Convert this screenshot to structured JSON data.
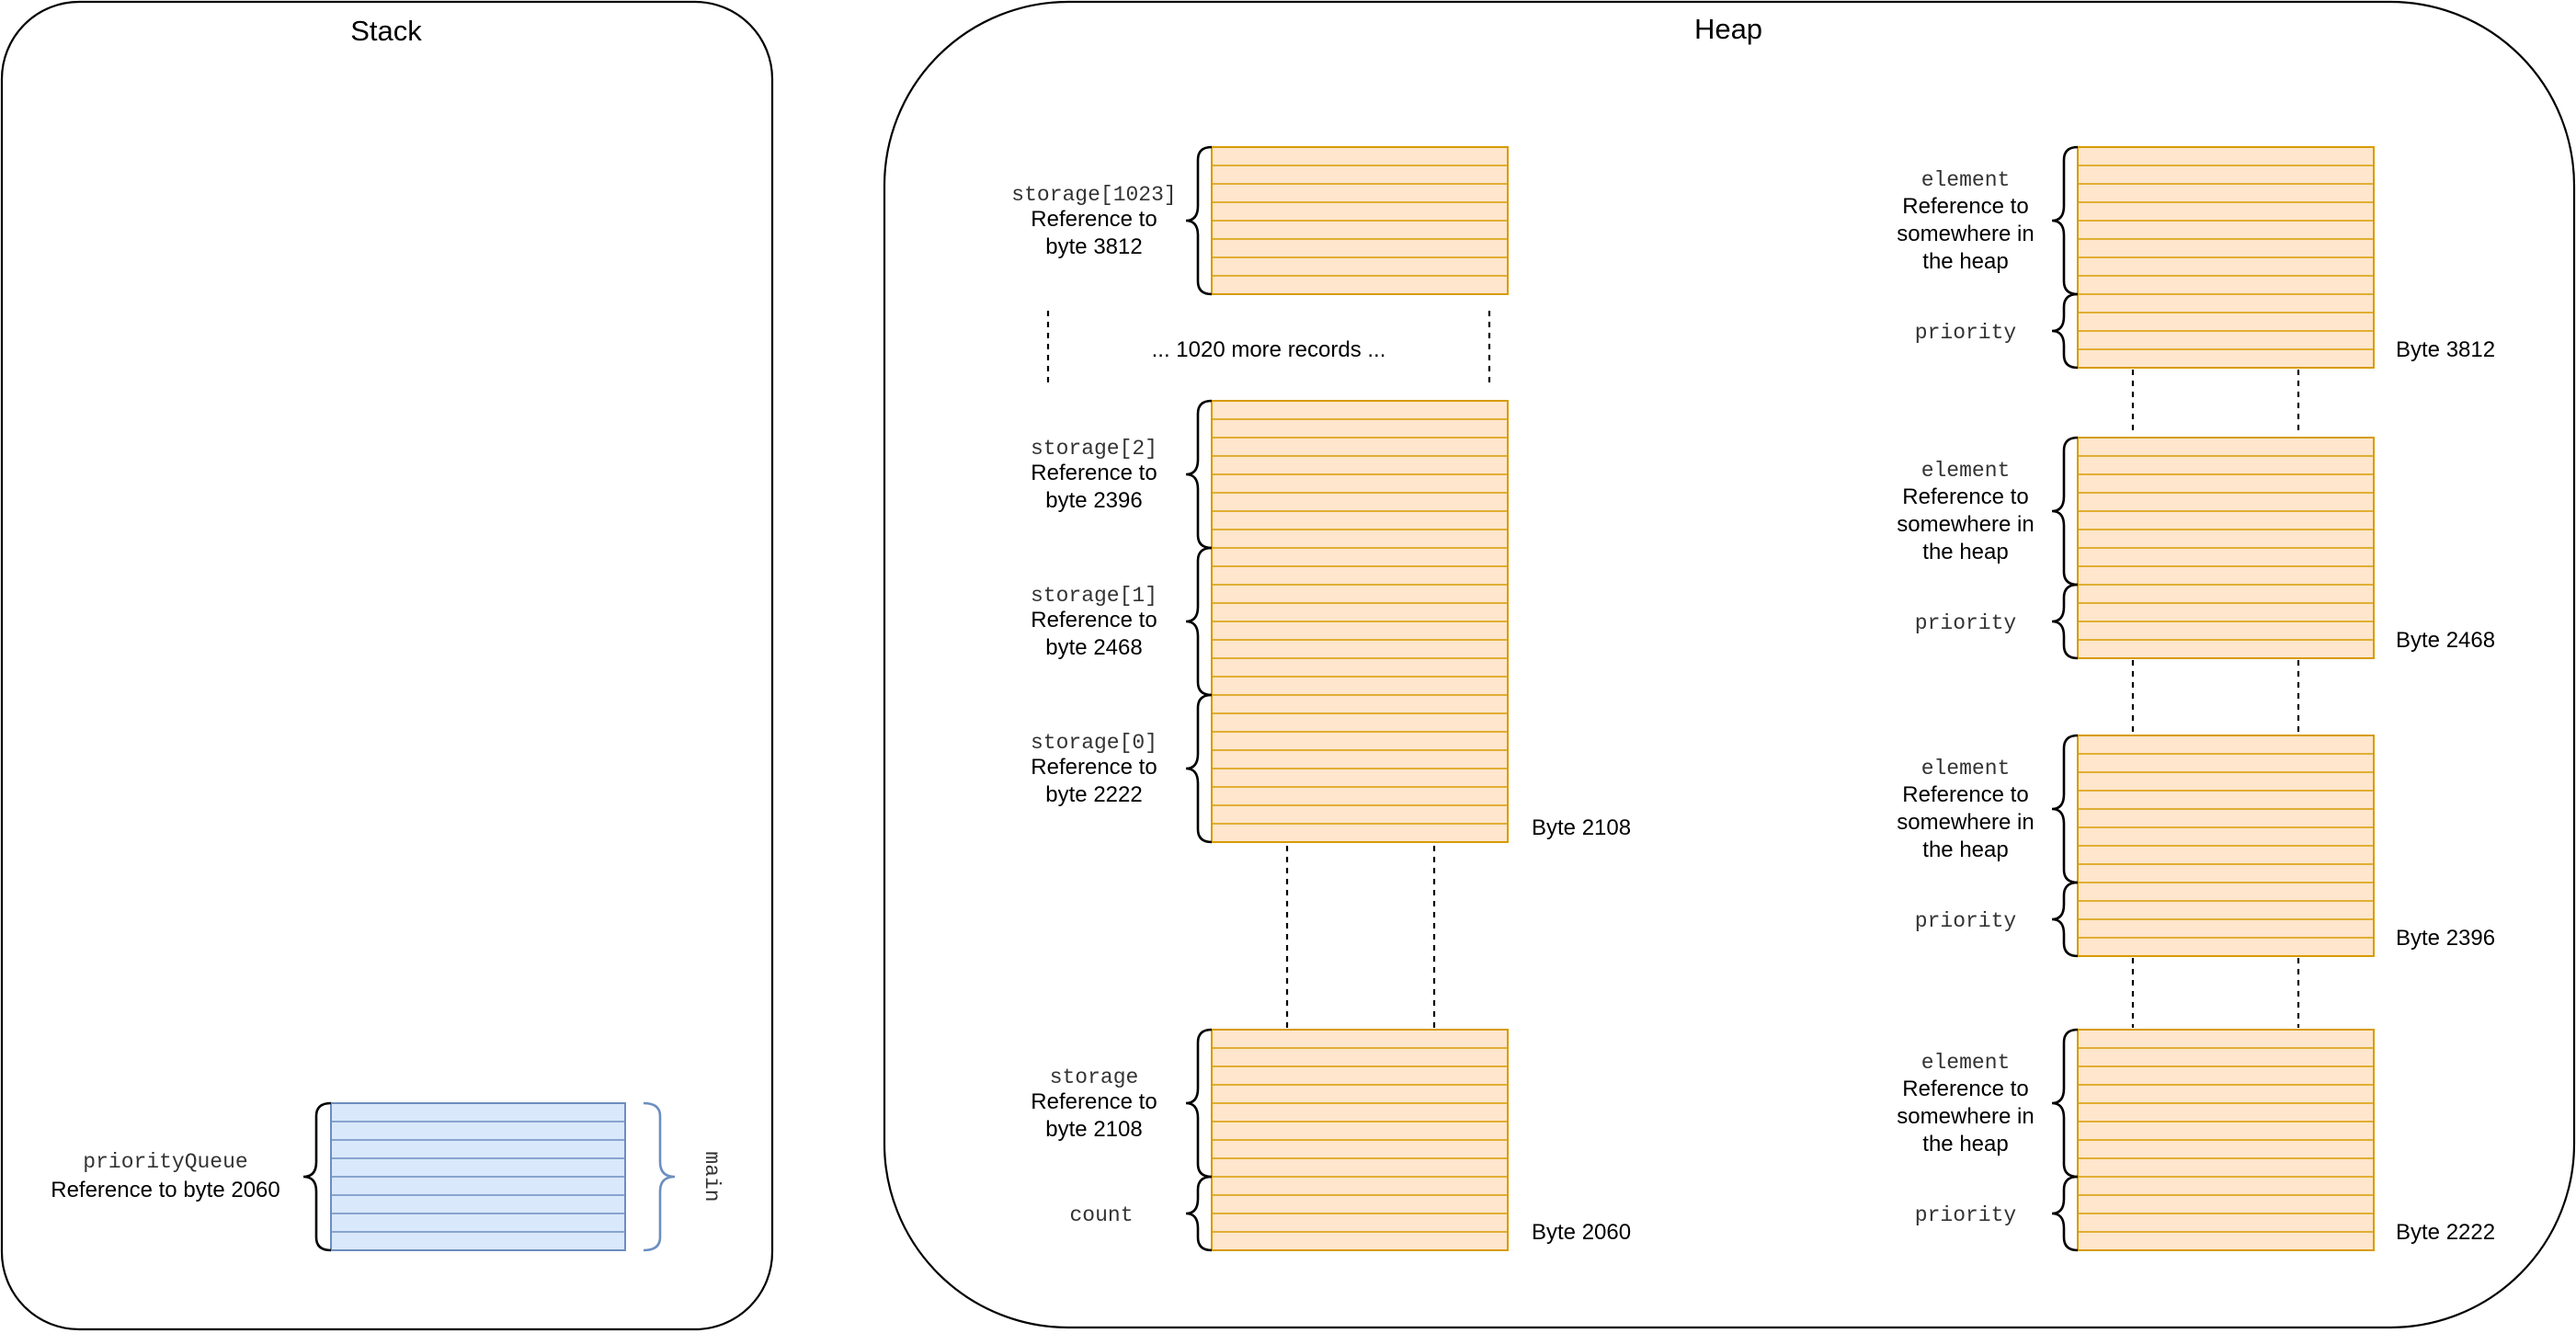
{
  "colors": {
    "stack_fill": "#dae8fc",
    "stack_stroke": "#6c8ebf",
    "heap_fill": "#ffe6cc",
    "heap_stroke": "#d79b00"
  },
  "stack": {
    "title": "Stack",
    "frame_label": "main",
    "priority_queue": {
      "name": "priorityQueue",
      "desc": "Reference to byte 2060"
    }
  },
  "heap": {
    "title": "Heap",
    "ellipsis": "... 1020 more records ...",
    "queue_object": {
      "storage_name": "storage",
      "storage_desc": [
        "Reference to",
        "byte 2108"
      ],
      "count_name": "count",
      "address": "Byte 2060"
    },
    "storage_array": {
      "address": "Byte 2108",
      "slots": [
        {
          "name": "storage[1023]",
          "desc": [
            "Reference to",
            "byte 3812"
          ]
        },
        {
          "name": "storage[2]",
          "desc": [
            "Reference to",
            "byte 2396"
          ]
        },
        {
          "name": "storage[1]",
          "desc": [
            "Reference to",
            "byte 2468"
          ]
        },
        {
          "name": "storage[0]",
          "desc": [
            "Reference to",
            "byte 2222"
          ]
        }
      ]
    },
    "records": [
      {
        "element_name": "element",
        "element_desc": [
          "Reference to",
          "somewhere in",
          "the heap"
        ],
        "priority_name": "priority",
        "address": "Byte 3812"
      },
      {
        "element_name": "element",
        "element_desc": [
          "Reference to",
          "somewhere in",
          "the heap"
        ],
        "priority_name": "priority",
        "address": "Byte 2468"
      },
      {
        "element_name": "element",
        "element_desc": [
          "Reference to",
          "somewhere in",
          "the heap"
        ],
        "priority_name": "priority",
        "address": "Byte 2396"
      },
      {
        "element_name": "element",
        "element_desc": [
          "Reference to",
          "somewhere in",
          "the heap"
        ],
        "priority_name": "priority",
        "address": "Byte 2222"
      }
    ]
  }
}
